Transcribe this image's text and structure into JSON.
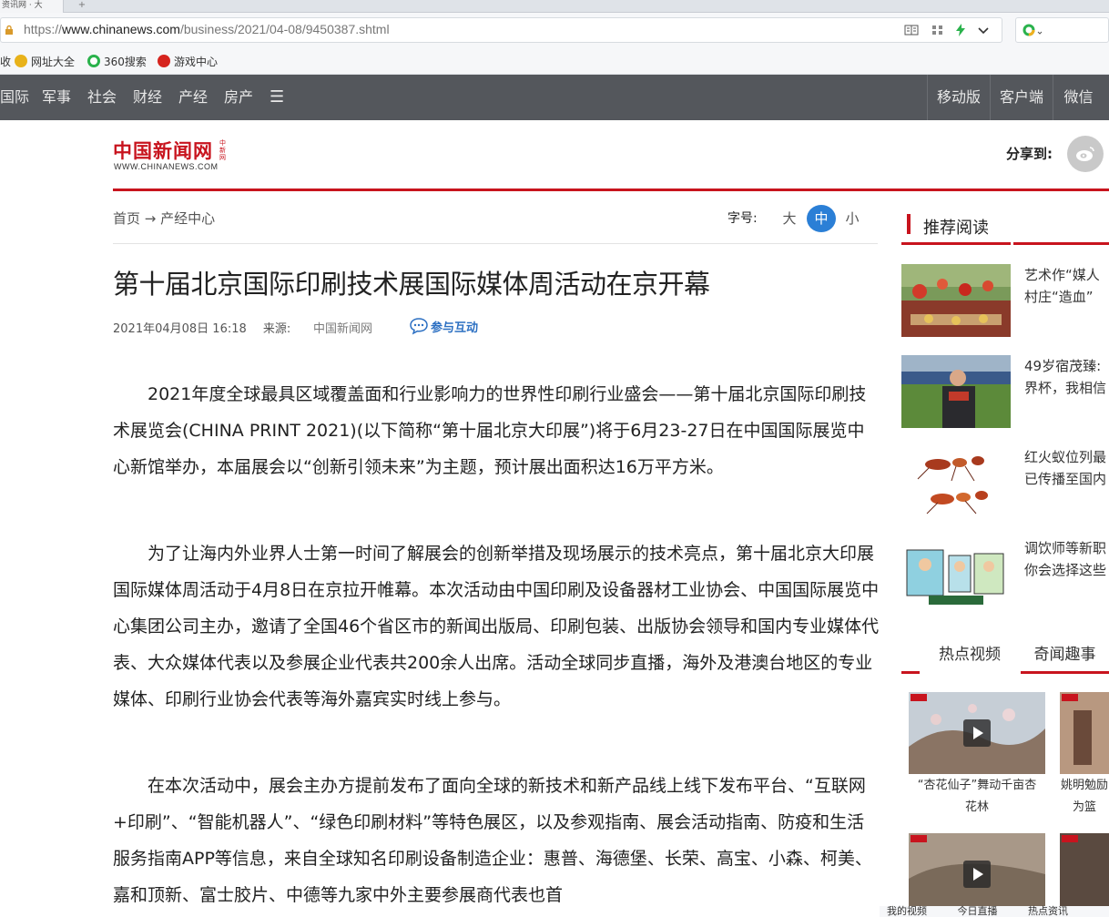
{
  "browser": {
    "tab_title": "资讯网 · 大",
    "url_prefix": "https://",
    "url_host": "www.chinanews.com",
    "url_path": "/business/2021/04-08/9450387.shtml",
    "bookmarks": [
      "收",
      "网址大全",
      "360搜索",
      "游戏中心"
    ]
  },
  "sitenav": {
    "left_items": [
      "国际",
      "军事",
      "社会",
      "财经",
      "产经",
      "房产"
    ],
    "menu_glyph": "☰",
    "right_items": [
      "移动版",
      "客户端",
      "微信"
    ]
  },
  "header": {
    "logo_cn": "中国新闻网",
    "logo_en": "WWW.CHINANEWS.COM",
    "logo_tag": "中新网",
    "share_label": "分享到:"
  },
  "breadcrumb": {
    "home": "首页",
    "arrow": "→",
    "section": "产经中心"
  },
  "font_size": {
    "label": "字号:",
    "options": [
      "大",
      "中",
      "小"
    ],
    "selected": "中"
  },
  "article": {
    "title": "第十届北京国际印刷技术展国际媒体周活动在京开幕",
    "datetime": "2021年04月08日 16:18",
    "source_label": "来源:",
    "source": "中国新闻网",
    "interact_label": "参与互动",
    "paragraphs": [
      "2021年度全球最具区域覆盖面和行业影响力的世界性印刷行业盛会——第十届北京国际印刷技术展览会(CHINA PRINT 2021)(以下简称“第十届北京大印展”)将于6月23-27日在中国国际展览中心新馆举办，本届展会以“创新引领未来”为主题，预计展出面积达16万平方米。",
      "为了让海内外业界人士第一时间了解展会的创新举措及现场展示的技术亮点，第十届北京大印展国际媒体周活动于4月8日在京拉开帷幕。本次活动由中国印刷及设备器材工业协会、中国国际展览中心集团公司主办，邀请了全国46个省区市的新闻出版局、印刷包装、出版协会领导和国内专业媒体代表、大众媒体代表以及参展企业代表共200余人出席。活动全球同步直播，海外及港澳台地区的专业媒体、印刷行业协会代表等海外嘉宾实时线上参与。",
      "在本次活动中，展会主办方提前发布了面向全球的新技术和新产品线上线下发布平台、“互联网+印刷”、“智能机器人”、“绿色印刷材料”等特色展区，以及参观指南、展会活动指南、防疫和生活服务指南APP等信息，来自全球知名印刷设备制造企业：惠普、海德堡、长荣、高宝、小森、柯美、嘉和顶新、富士胶片、中德等九家中外主要参展商代表也首"
    ]
  },
  "sidebar": {
    "recommend_title": "推荐阅读",
    "items": [
      {
        "line1": "艺术作“媒人",
        "line2": "村庄“造血”"
      },
      {
        "line1": "49岁宿茂臻:",
        "line2": "界杯，我相信"
      },
      {
        "line1": "红火蚁位列最",
        "line2": "已传播至国内"
      },
      {
        "line1": "调饮师等新职",
        "line2": "你会选择这些"
      }
    ],
    "tabs": [
      "热点视频",
      "奇闻趣事"
    ],
    "videos": [
      {
        "line1": "“杏花仙子”舞动千亩杏",
        "line2": "花林"
      },
      {
        "line1": "姚明勉励",
        "line2": "为篮"
      }
    ]
  },
  "statusbar": {
    "items": [
      "我的视频",
      "今日直播",
      "热点资讯"
    ]
  }
}
